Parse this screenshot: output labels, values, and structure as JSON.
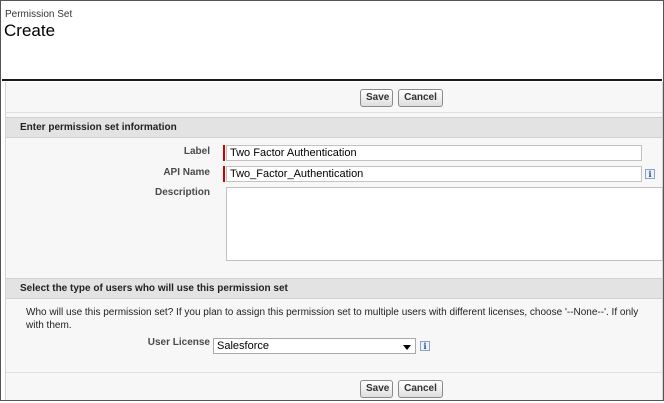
{
  "header": {
    "breadcrumb": "Permission Set",
    "title": "Create"
  },
  "buttons": {
    "save_label": "Save",
    "cancel_label": "Cancel"
  },
  "section_info": {
    "title": "Enter permission set information",
    "label_field": {
      "label": "Label",
      "value": "Two Factor Authentication"
    },
    "api_name_field": {
      "label": "API Name",
      "value": "Two_Factor_Authentication",
      "info_glyph": "i"
    },
    "description_field": {
      "label": "Description",
      "value": ""
    }
  },
  "section_users": {
    "title": "Select the type of users who will use this permission set",
    "help_line1": "Who will use this permission set? If you plan to assign this permission set to multiple users with different licenses, choose '--None--'. If only",
    "help_line2": "with them.",
    "user_license": {
      "label": "User License",
      "selected": "Salesforce",
      "info_glyph": "i"
    }
  },
  "colors": {
    "required_bar": "#cc0000",
    "section_header_bg": "#e3e3e3",
    "panel_bg": "#f7f7f7"
  },
  "icons": [
    "info-icon",
    "dropdown-arrow-icon"
  ]
}
